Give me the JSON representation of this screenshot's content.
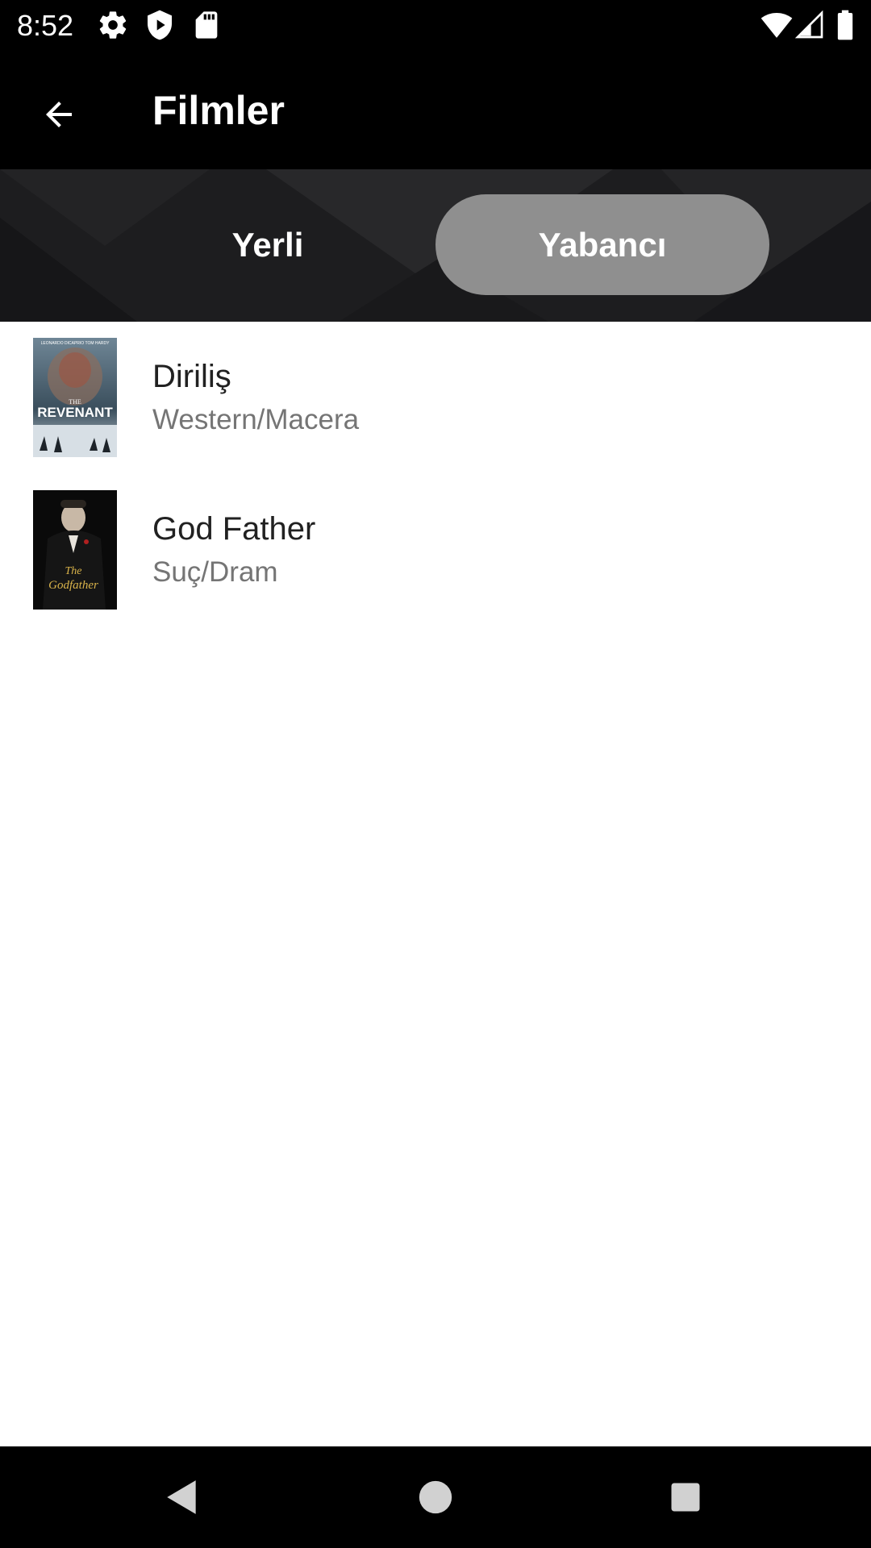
{
  "status_bar": {
    "time": "8:52",
    "icons": [
      "settings-gear-icon",
      "shield-play-icon",
      "sd-card-icon",
      "wifi-icon",
      "cell-signal-icon",
      "battery-icon"
    ]
  },
  "app_bar": {
    "title": "Filmler",
    "back_icon": "arrow-back-icon"
  },
  "tabs": [
    {
      "label": "Yerli",
      "selected": false
    },
    {
      "label": "Yabancı",
      "selected": true
    }
  ],
  "movies": [
    {
      "title": "Diriliş",
      "genre": "Western/Macera",
      "poster": "poster-revenant"
    },
    {
      "title": "God Father",
      "genre": "Suç/Dram",
      "poster": "poster-godfather"
    }
  ],
  "posters": {
    "revenant": {
      "top_text": "LEONARDO DICAPRIO   TOM HARDY",
      "the": "THE",
      "title": "REVENANT"
    },
    "godfather": {
      "the": "The",
      "title": "Godfather"
    }
  },
  "nav_bar": {
    "icons": [
      "back-triangle-icon",
      "home-circle-icon",
      "recents-square-icon"
    ]
  },
  "colors": {
    "bar_background": "#000000",
    "tab_header_background": "#1b1b1d",
    "selected_tab": "#8f8f8f",
    "title_text": "#212121",
    "subtitle_text": "#757575"
  }
}
